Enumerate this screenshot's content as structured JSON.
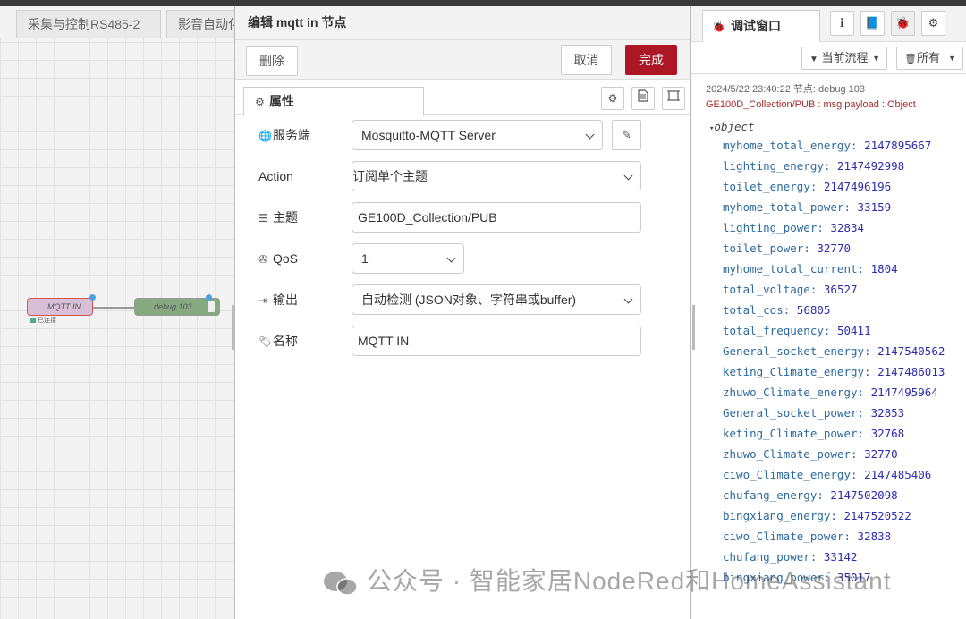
{
  "workspace": {
    "tabs": [
      "采集与控制RS485-2",
      "影音自动化"
    ],
    "nodes": {
      "mqtt_in": {
        "label": "MQTT IN",
        "status": "已连接"
      },
      "debug": {
        "label": "debug 103"
      }
    }
  },
  "tray": {
    "title": "编辑 mqtt in 节点",
    "delete_label": "删除",
    "cancel_label": "取消",
    "done_label": "完成",
    "tab_properties": "属性",
    "fields": {
      "server": {
        "label": "服务端",
        "value": "Mosquitto-MQTT Server"
      },
      "action": {
        "label": "Action",
        "value": "订阅单个主题"
      },
      "topic": {
        "label": "主题",
        "value": "GE100D_Collection/PUB"
      },
      "qos": {
        "label": "QoS",
        "value": "1"
      },
      "output": {
        "label": "输出",
        "value": "自动检测 (JSON对象、字符串或buffer)"
      },
      "name": {
        "label": "名称",
        "value": "MQTT IN"
      }
    }
  },
  "sidebar": {
    "tab_label": "调试窗口",
    "filter_flow": "当前流程",
    "filter_all": "所有",
    "message": {
      "meta": "2024/5/22 23:40:22   节点: debug 103",
      "topic": "GE100D_Collection/PUB : msg.payload : Object",
      "type": "object",
      "properties": [
        {
          "key": "myhome_total_energy",
          "value": "2147895667"
        },
        {
          "key": "lighting_energy",
          "value": "2147492998"
        },
        {
          "key": "toilet_energy",
          "value": "2147496196"
        },
        {
          "key": "myhome_total_power",
          "value": "33159"
        },
        {
          "key": "lighting_power",
          "value": "32834"
        },
        {
          "key": "toilet_power",
          "value": "32770"
        },
        {
          "key": "myhome_total_current",
          "value": "1804"
        },
        {
          "key": "total_voltage",
          "value": "36527"
        },
        {
          "key": "total_cos",
          "value": "56805"
        },
        {
          "key": "total_frequency",
          "value": "50411"
        },
        {
          "key": "General_socket_energy",
          "value": "2147540562"
        },
        {
          "key": "keting_Climate_energy",
          "value": "2147486013"
        },
        {
          "key": "zhuwo_Climate_energy",
          "value": "2147495964"
        },
        {
          "key": "General_socket_power",
          "value": "32853"
        },
        {
          "key": "keting_Climate_power",
          "value": "32768"
        },
        {
          "key": "zhuwo_Climate_power",
          "value": "32770"
        },
        {
          "key": "ciwo_Climate_energy",
          "value": "2147485406"
        },
        {
          "key": "chufang_energy",
          "value": "2147502098"
        },
        {
          "key": "bingxiang_energy",
          "value": "2147520522"
        },
        {
          "key": "ciwo_Climate_power",
          "value": "32838"
        },
        {
          "key": "chufang_power",
          "value": "33142"
        },
        {
          "key": "bingxiang_power",
          "value": "35017"
        }
      ]
    }
  },
  "watermark": "公众号 · 智能家居NodeRed和HomeAssistant"
}
